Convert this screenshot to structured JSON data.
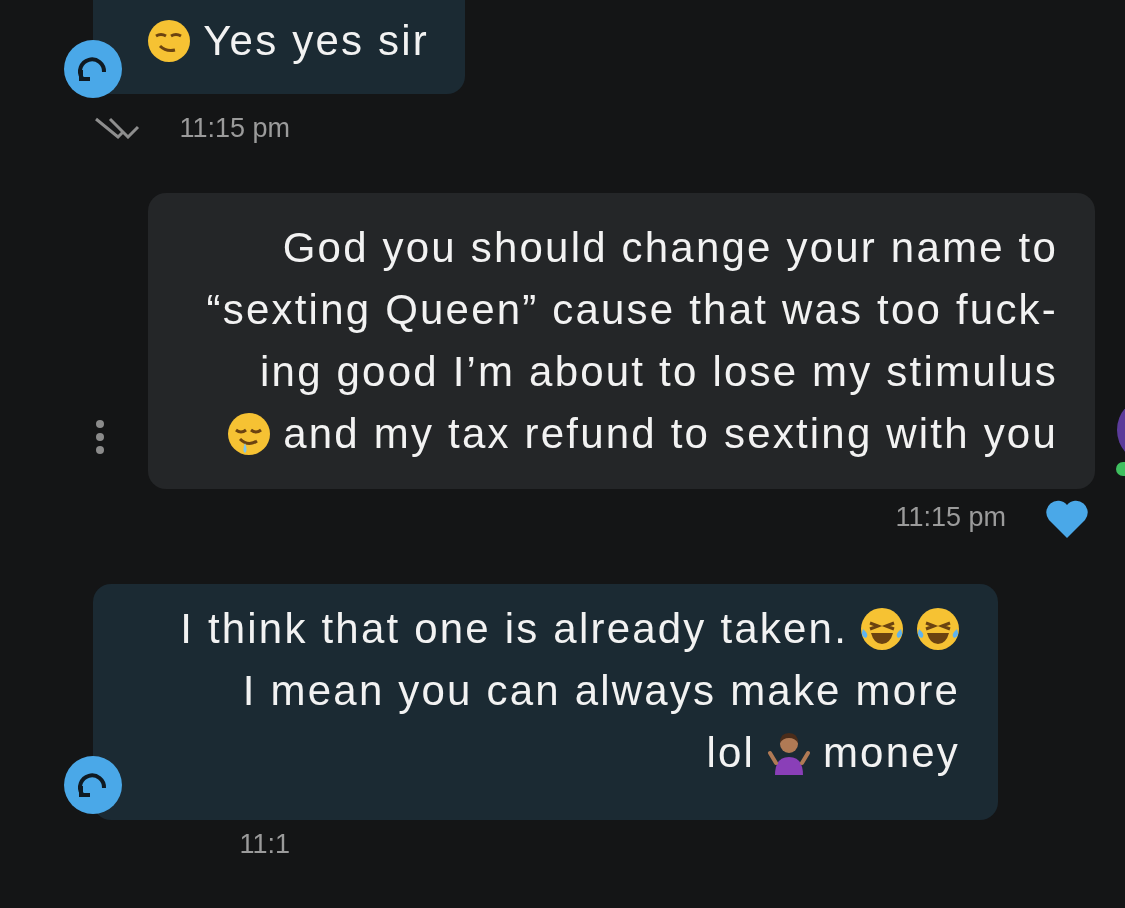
{
  "avatar": {
    "online": true
  },
  "messages": [
    {
      "kind": "received",
      "shortcut": true,
      "menu": false,
      "read": true,
      "liked": false,
      "time": "11:15 pm",
      "lines": [
        [
          {
            "kind": "smirk"
          },
          {
            "kind": "text",
            "text": "Yes yes sir"
          }
        ]
      ]
    },
    {
      "kind": "sent",
      "shortcut": false,
      "menu": true,
      "read": false,
      "liked": true,
      "time": "11:15 pm",
      "lines": [
        [
          {
            "kind": "text",
            "text": "God you should change your name to"
          }
        ],
        [
          {
            "kind": "text",
            "text": "“sexting Queen” cause that was too fuck-"
          }
        ],
        [
          {
            "kind": "text",
            "text": "ing good I’m about to lose my stimulus"
          }
        ],
        [
          {
            "kind": "drool"
          },
          {
            "kind": "text",
            "text": "and my tax refund to sexting with you"
          }
        ]
      ]
    },
    {
      "kind": "received",
      "shortcut": true,
      "menu": false,
      "read": false,
      "liked": false,
      "time": "11:1",
      "lines": [
        [
          {
            "kind": "text",
            "text": "I think that one is already taken."
          },
          {
            "kind": "laugh"
          },
          {
            "kind": "laugh"
          }
        ],
        [
          {
            "kind": "text",
            "text": "I mean you can always make more"
          }
        ],
        [
          {
            "kind": "text",
            "text": "lol"
          },
          {
            "kind": "shrug"
          },
          {
            "kind": "text",
            "text": "money"
          }
        ]
      ]
    }
  ]
}
